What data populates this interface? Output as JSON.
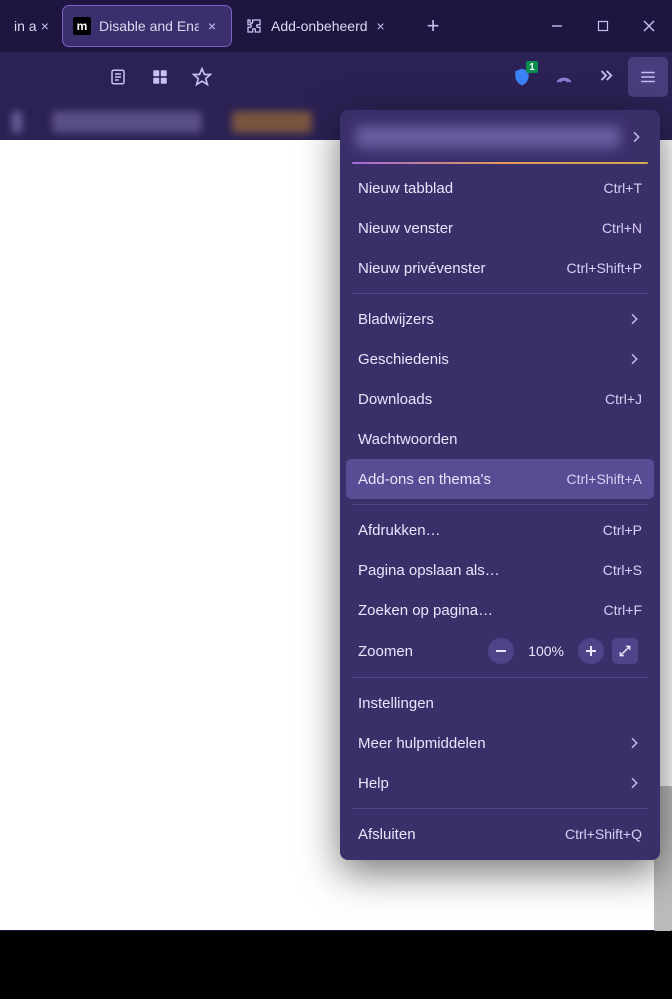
{
  "titlebar": {
    "tabs": [
      {
        "label": "in a",
        "close": "×"
      },
      {
        "label": "Disable and Ena",
        "close": "×"
      },
      {
        "label": "Add-onbeheerd",
        "close": "×"
      }
    ],
    "newtab": "+"
  },
  "toolbar": {
    "shield_badge": "1"
  },
  "menu": {
    "items_a": [
      {
        "label": "Nieuw tabblad",
        "shortcut": "Ctrl+T"
      },
      {
        "label": "Nieuw venster",
        "shortcut": "Ctrl+N"
      },
      {
        "label": "Nieuw privévenster",
        "shortcut": "Ctrl+Shift+P"
      }
    ],
    "items_b": [
      {
        "label": "Bladwijzers",
        "arrow": true
      },
      {
        "label": "Geschiedenis",
        "arrow": true
      },
      {
        "label": "Downloads",
        "shortcut": "Ctrl+J"
      },
      {
        "label": "Wachtwoorden"
      },
      {
        "label": "Add-ons en thema's",
        "shortcut": "Ctrl+Shift+A",
        "hl": true
      }
    ],
    "items_c": [
      {
        "label": "Afdrukken…",
        "shortcut": "Ctrl+P"
      },
      {
        "label": "Pagina opslaan als…",
        "shortcut": "Ctrl+S"
      },
      {
        "label": "Zoeken op pagina…",
        "shortcut": "Ctrl+F"
      }
    ],
    "zoom": {
      "label": "Zoomen",
      "value": "100%"
    },
    "items_d": [
      {
        "label": "Instellingen"
      },
      {
        "label": "Meer hulpmiddelen",
        "arrow": true
      },
      {
        "label": "Help",
        "arrow": true
      }
    ],
    "items_e": [
      {
        "label": "Afsluiten",
        "shortcut": "Ctrl+Shift+Q"
      }
    ]
  }
}
